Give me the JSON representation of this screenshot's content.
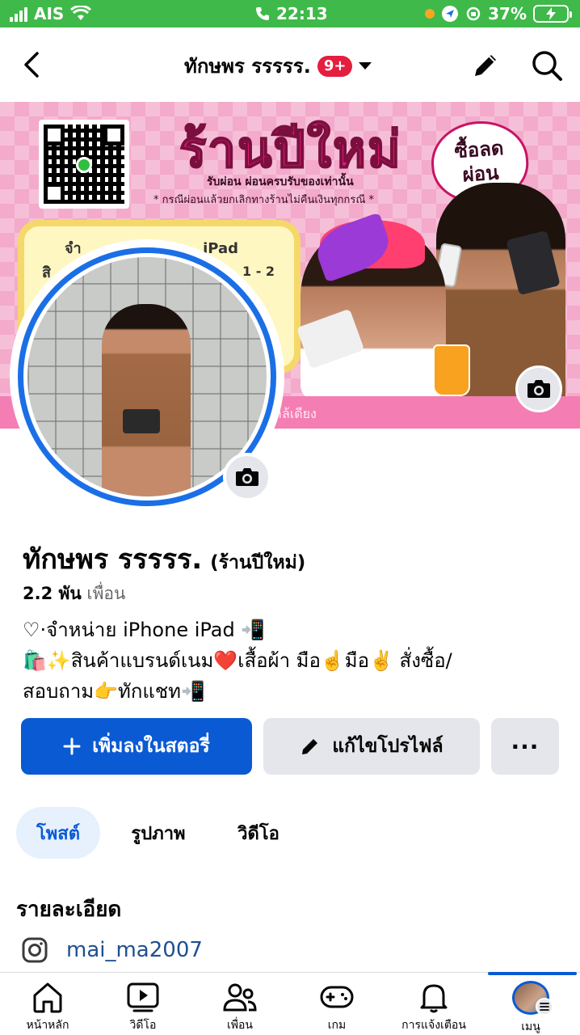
{
  "status_bar": {
    "carrier": "AIS",
    "time": "22:13",
    "battery": "37%"
  },
  "header": {
    "title": "ทักษพร รรรรร.",
    "badge": "9+"
  },
  "cover": {
    "shop_title": "ร้านปีใหม่",
    "sub_line1": "รับผ่อน ผ่อนครบรับของเท่านั้น",
    "sub_line2": "* กรณีผ่อนแล้วยกเลิกทางร้านไม่คืนเงินทุกกรณี *",
    "heart_line1": "ซื้อลด",
    "heart_line2": "ผ่อน",
    "frame_text1": "จำ",
    "frame_text2": "สิ",
    "frame_text3": "1 - 2",
    "frame_ipad": "iPad",
    "caption": "าล้เดียง"
  },
  "profile": {
    "name": "ทักษพร รรรรร.",
    "alternate_name": "(ร้านปีใหม่)",
    "friends_count": "2.2 พัน",
    "friends_label": "เพื่อน",
    "bio_line1": "♡·จำหน่าย iPhone  iPad 📲",
    "bio_line2": "🛍️✨สินค้าแบรนด์เนม❤️เสื้อผ้า มือ☝️มือ✌️ สั่งซื้อ/",
    "bio_line3": "สอบถาม👉ทักแชท📲"
  },
  "actions": {
    "add_story": "เพิ่มลงในสตอรี่",
    "edit_profile": "แก้ไขโปรไฟล์",
    "more": "···"
  },
  "tabs": [
    {
      "label": "โพสต์",
      "active": true
    },
    {
      "label": "รูปภาพ",
      "active": false
    },
    {
      "label": "วิดีโอ",
      "active": false
    }
  ],
  "details": {
    "title": "รายละเอียด",
    "instagram": "mai_ma2007"
  },
  "bottom_nav": [
    {
      "label": "หน้าหลัก",
      "icon": "home-icon"
    },
    {
      "label": "วิดีโอ",
      "icon": "video-icon"
    },
    {
      "label": "เพื่อน",
      "icon": "friends-icon"
    },
    {
      "label": "เกม",
      "icon": "gaming-icon"
    },
    {
      "label": "การแจ้งเตือน",
      "icon": "bell-icon"
    },
    {
      "label": "เมนู",
      "icon": "menu-avatar",
      "active": true
    }
  ],
  "colors": {
    "status_bar": "#3fb949",
    "primary_blue": "#0a5ad4",
    "badge_red": "#e41e3f",
    "cover_pink": "#f6bfd8"
  }
}
